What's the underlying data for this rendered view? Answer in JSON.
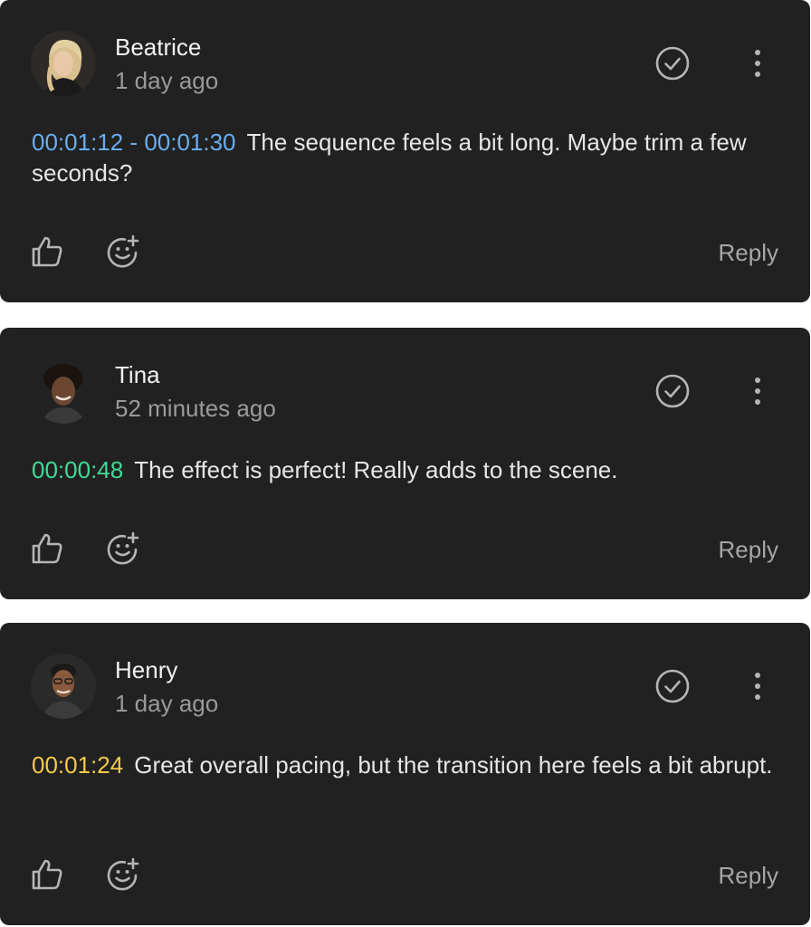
{
  "comments": [
    {
      "author": "Beatrice",
      "time_ago": "1 day ago",
      "timestamp": "00:01:12 - 00:01:30",
      "timestamp_color": "#6aaef0",
      "text": "The sequence feels a bit long. Maybe trim a few seconds?",
      "reply_label": "Reply",
      "avatar_icon": "avatar-photo"
    },
    {
      "author": "Tina",
      "time_ago": "52 minutes ago",
      "timestamp": "00:00:48",
      "timestamp_color": "#3ddc97",
      "text": "The effect is perfect! Really adds to the scene.",
      "reply_label": "Reply",
      "avatar_icon": "avatar-photo"
    },
    {
      "author": "Henry",
      "time_ago": "1 day ago",
      "timestamp": "00:01:24",
      "timestamp_color": "#f5c84c",
      "text": "Great overall pacing, but the transition here feels a bit abrupt.",
      "reply_label": "Reply",
      "avatar_icon": "avatar-photo"
    }
  ],
  "icons": {
    "resolve": "check-circle-icon",
    "more": "more-vertical-icon",
    "like": "thumbs-up-icon",
    "react": "add-emoji-icon"
  },
  "colors": {
    "card_bg": "#212121",
    "page_bg": "#ffffff",
    "name": "#f2f2f2",
    "muted": "#9a9a9a"
  }
}
